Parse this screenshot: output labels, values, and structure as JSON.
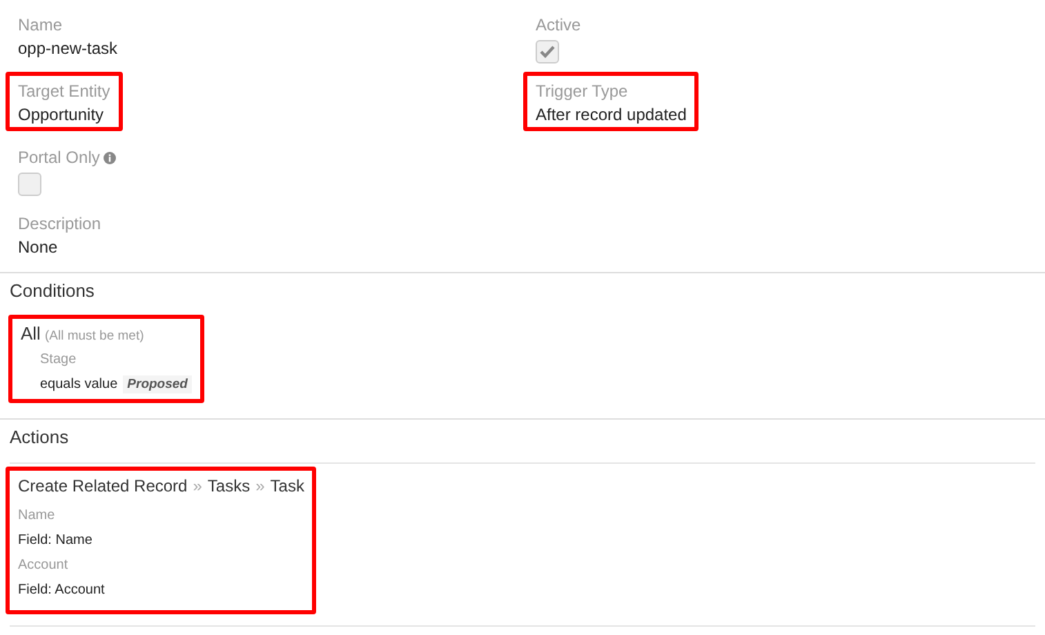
{
  "field_rows": [
    [
      {
        "kind": "text",
        "label": "Name",
        "value": "opp-new-task",
        "highlighted": false
      },
      {
        "kind": "checkbox",
        "label": "Active",
        "checked": true,
        "highlighted": false
      }
    ],
    [
      {
        "kind": "text",
        "label": "Target Entity",
        "value": "Opportunity",
        "highlighted": true
      },
      {
        "kind": "text",
        "label": "Trigger Type",
        "value": "After record updated",
        "highlighted": true
      }
    ],
    [
      {
        "kind": "checkbox",
        "label": "Portal Only",
        "checked": false,
        "info": true,
        "highlighted": false
      }
    ],
    [
      {
        "kind": "text",
        "label": "Description",
        "value": "None",
        "highlighted": false
      }
    ]
  ],
  "conditions": {
    "title": "Conditions",
    "group": {
      "name": "All",
      "note": "(All must be met)",
      "highlighted": true,
      "items": [
        {
          "field": "Stage",
          "operator": "equals value",
          "value": "Proposed"
        }
      ]
    }
  },
  "actions": {
    "title": "Actions",
    "items": [
      {
        "type": "Create Related Record",
        "path": [
          "Tasks",
          "Task"
        ],
        "separator": "»",
        "highlighted": true,
        "fields": [
          {
            "label": "Name",
            "value": "Field: Name"
          },
          {
            "label": "Account",
            "value": "Field: Account"
          }
        ]
      }
    ]
  }
}
